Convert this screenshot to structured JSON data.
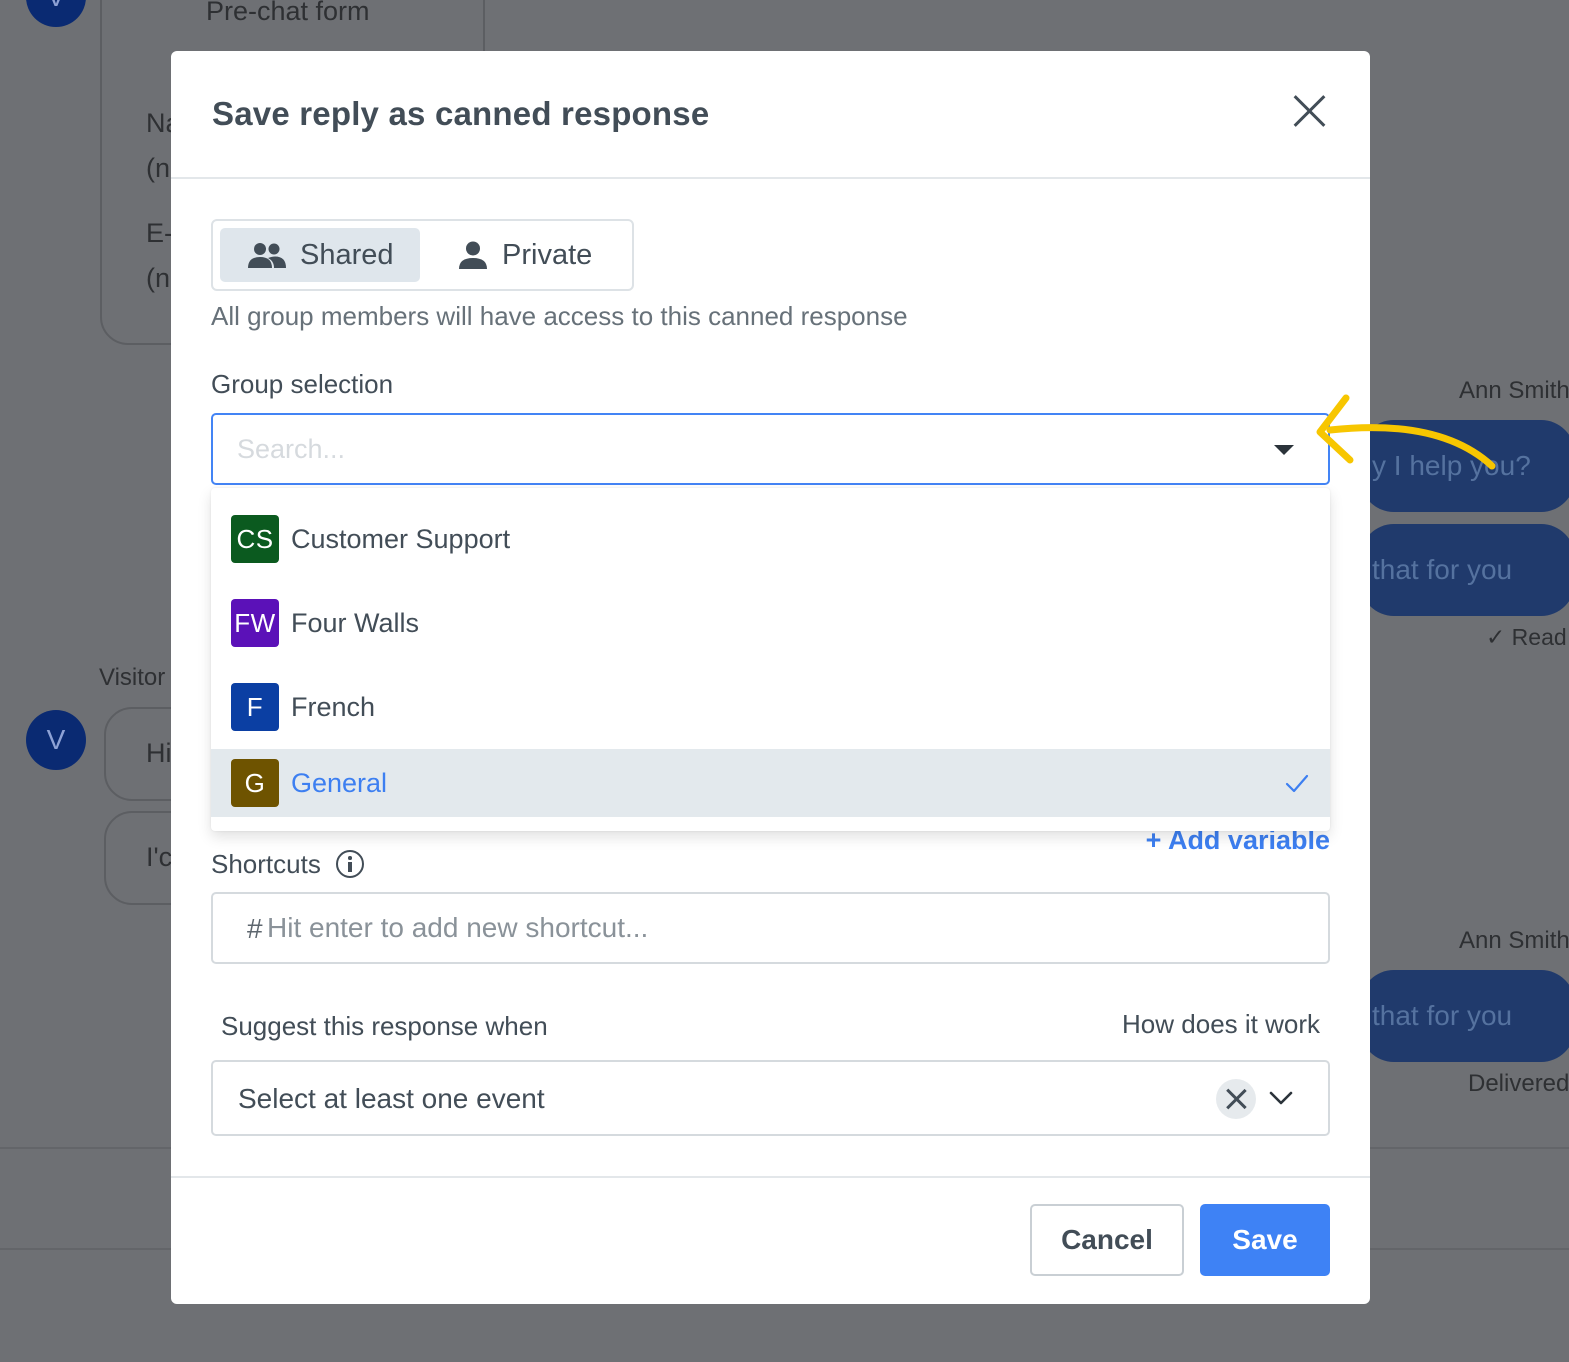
{
  "background": {
    "prechat_title": "Pre-chat form",
    "form_frag_name": "Na",
    "form_frag_name_val": "(n",
    "form_frag_email": "E-",
    "form_frag_email_val": "(n",
    "visitor_label": "Visitor",
    "visitor_avatar": "V",
    "visitor_msg1": "Hi",
    "visitor_msg2": "I'c",
    "agent_name_1": "Ann Smith",
    "agent_msg_1": "y I help you?",
    "agent_msg_2": "that for you",
    "read_status": "✓ Read",
    "agent_name_2": "Ann Smith",
    "agent_msg_3": "that for you",
    "delivered_status": "Delivered"
  },
  "modal": {
    "title": "Save reply as canned response",
    "close_icon": "close-icon",
    "visibility": {
      "shared_label": "Shared",
      "private_label": "Private",
      "selected": "Shared",
      "helper": "All group members will have access to this canned response"
    },
    "group_selection": {
      "label": "Group selection",
      "placeholder": "Search...",
      "options": [
        {
          "initials": "CS",
          "name": "Customer Support",
          "color": "#0b5a1f",
          "selected": false
        },
        {
          "initials": "FW",
          "name": "Four Walls",
          "color": "#5b11b8",
          "selected": false
        },
        {
          "initials": "F",
          "name": "French",
          "color": "#0b3fa3",
          "selected": false
        },
        {
          "initials": "G",
          "name": "General",
          "color": "#6e5300",
          "selected": true
        }
      ]
    },
    "add_variable": "+ Add variable",
    "shortcuts": {
      "label": "Shortcuts",
      "hash": "#",
      "placeholder": "Hit enter to add new shortcut..."
    },
    "suggest": {
      "label": "Suggest this response when",
      "how_link": "How does it work",
      "value": "Select at least one event"
    },
    "footer": {
      "cancel_label": "Cancel",
      "save_label": "Save"
    }
  },
  "colors": {
    "accent": "#3e82f5",
    "annotation": "#f7c600"
  }
}
